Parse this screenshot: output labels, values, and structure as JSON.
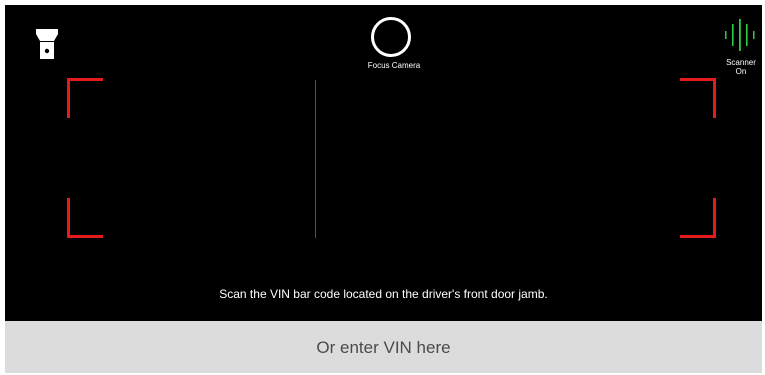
{
  "toolbar": {
    "flashlight_icon": "flashlight-icon",
    "focus_icon": "focus-ring-icon",
    "focus_label": "Focus Camera",
    "scanner_icon": "scanner-signal-icon",
    "scanner_label_line1": "Scanner",
    "scanner_label_line2": "On"
  },
  "viewfinder": {
    "instruction": "Scan the VIN bar code located on the driver's front door jamb.",
    "frame_color": "#e31b1b",
    "scan_line_color": "#c81a1a"
  },
  "vin_entry": {
    "label": "Or enter VIN here"
  },
  "colors": {
    "camera_background": "#000000",
    "scanner_active": "#2ecc40",
    "entry_background": "#dcdcdc",
    "entry_text": "#4b4b4b"
  }
}
